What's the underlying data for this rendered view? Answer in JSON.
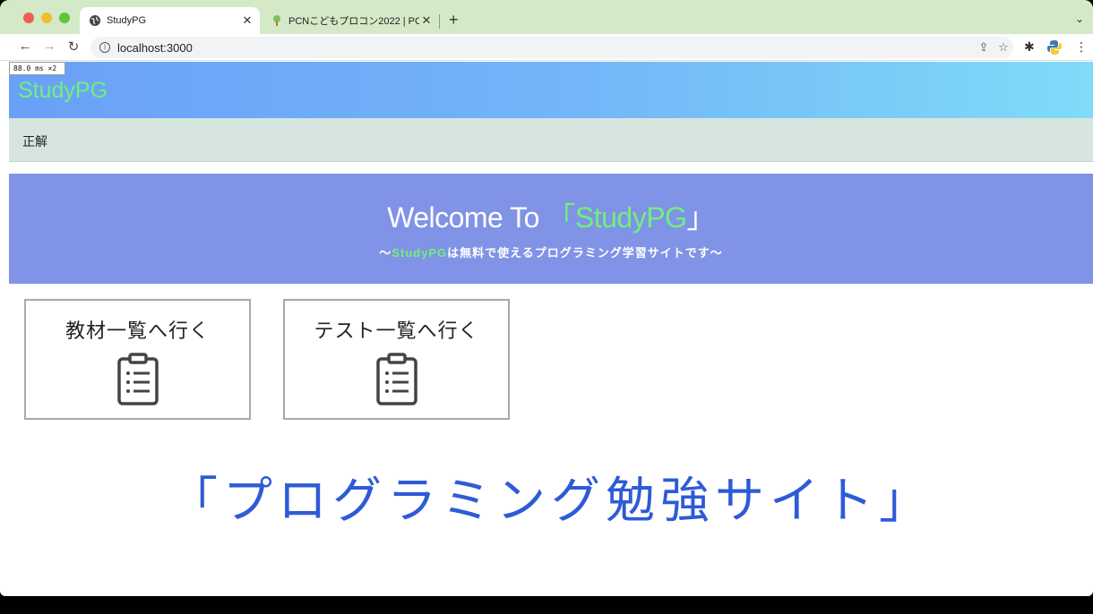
{
  "browser": {
    "tabs": [
      {
        "title": "StudyPG",
        "active": true
      },
      {
        "title": "PCNこどもプロコン2022 | PCN",
        "active": false
      }
    ],
    "new_tab": "+",
    "url": "localhost:3000",
    "perf_overlay": "88.0 ms ×2"
  },
  "site": {
    "brand": "StudyPG",
    "subnav_link": "正解",
    "hero": {
      "welcome": "Welcome To",
      "open_bracket": "「",
      "name": "StudyPG",
      "close_bracket": "」",
      "sub_prefix": "〜",
      "sub_name": "StudyPG",
      "sub_rest": "は無料で使えるプログラミング学習サイトです〜"
    },
    "cards": [
      {
        "label": "教材一覧へ行く",
        "icon": "clipboard-list-icon"
      },
      {
        "label": "テスト一覧へ行く",
        "icon": "clipboard-list-icon"
      }
    ],
    "tagline": "「プログラミング勉強サイト」"
  },
  "colors": {
    "brand_green": "#6ff07a",
    "hero_bg": "#8093e6",
    "tagline_blue": "#2e5bd6",
    "subbar_bg": "#d6e5de"
  }
}
